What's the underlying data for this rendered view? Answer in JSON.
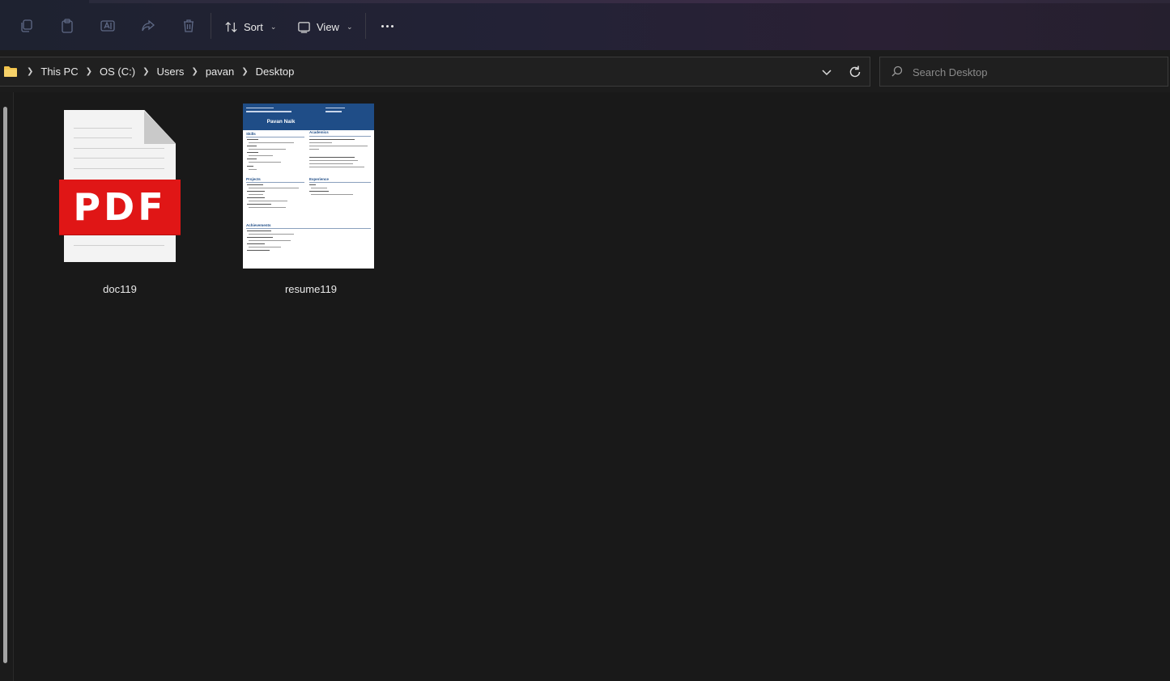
{
  "toolbar": {
    "icons": [
      "copy-icon",
      "paste-icon",
      "rename-icon",
      "share-icon",
      "delete-icon"
    ],
    "sort_label": "Sort",
    "view_label": "View"
  },
  "address": {
    "crumbs": [
      "This PC",
      "OS (C:)",
      "Users",
      "pavan",
      "Desktop"
    ]
  },
  "search": {
    "placeholder": "Search Desktop"
  },
  "files": [
    {
      "name": "doc119",
      "type": "pdf",
      "icon_text": "PDF"
    },
    {
      "name": "resume119",
      "type": "image",
      "thumbnail": {
        "person_name": "Pavan Naik",
        "sections_left": [
          "Skills",
          "Projects",
          "Achievements"
        ],
        "sections_right": [
          "Academics",
          "Experience"
        ]
      }
    }
  ],
  "colors": {
    "pdf_red": "#e01616",
    "resume_header_blue": "#1f4d87",
    "folder_yellow": "#f2c44b"
  }
}
